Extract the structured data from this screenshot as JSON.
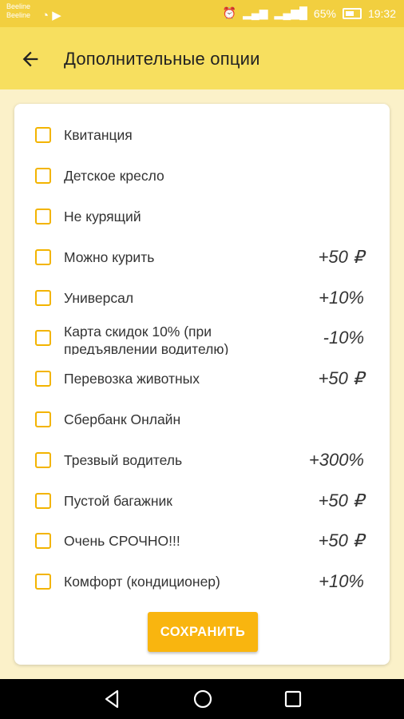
{
  "status_bar": {
    "carrier_top": "Beeline",
    "carrier_bottom": "Beeline",
    "battery_percent": "65%",
    "time": "19:32"
  },
  "app_bar": {
    "title": "Дополнительные опции",
    "back_icon": "arrow-left-icon"
  },
  "options": [
    {
      "label": "Квитанция",
      "price": "",
      "checked": false
    },
    {
      "label": "Детское кресло",
      "price": "",
      "checked": false
    },
    {
      "label": "Не курящий",
      "price": "",
      "checked": false
    },
    {
      "label": "Можно курить",
      "price": "+50 ₽",
      "checked": false
    },
    {
      "label": "Универсал",
      "price": "+10%",
      "checked": false
    },
    {
      "label": "Карта скидок 10% (при предъявлении водителю)",
      "price": "-10%",
      "checked": false
    },
    {
      "label": "Перевозка животных",
      "price": "+50 ₽",
      "checked": false
    },
    {
      "label": "Сбербанк Онлайн",
      "price": "",
      "checked": false
    },
    {
      "label": "Трезвый водитель",
      "price": "+300%",
      "checked": false
    },
    {
      "label": "Пустой багажник",
      "price": "+50 ₽",
      "checked": false
    },
    {
      "label": "Очень СРОЧНО!!!",
      "price": "+50 ₽",
      "checked": false
    },
    {
      "label": "Комфорт (кондиционер)",
      "price": "+10%",
      "checked": false
    }
  ],
  "save_button": {
    "label": "СОХРАНИТЬ"
  },
  "colors": {
    "status_bar": "#f2cf3f",
    "app_bar": "#f7df5f",
    "accent": "#f9b50f",
    "checkbox": "#f3b400"
  },
  "nav_bar": {
    "back_icon": "triangle-back-icon",
    "home_icon": "circle-home-icon",
    "recents_icon": "square-recents-icon"
  }
}
